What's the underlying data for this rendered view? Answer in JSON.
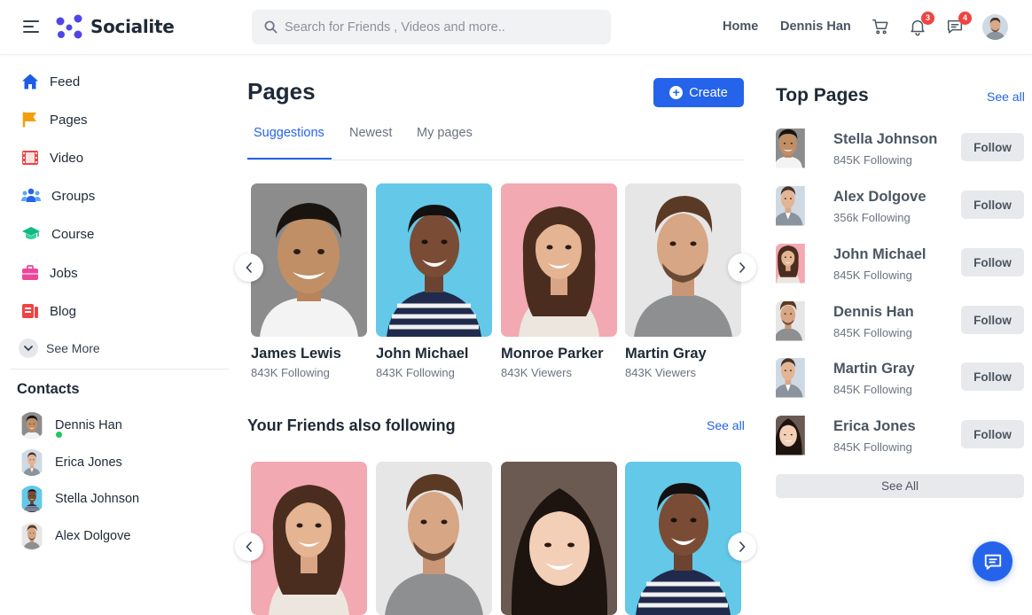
{
  "header": {
    "app_name": "Socialite",
    "search_placeholder": "Search for Friends , Videos and more..",
    "nav_home": "Home",
    "nav_user": "Dennis Han",
    "notifications_count": "3",
    "messages_count": "4",
    "icons": [
      "menu-icon",
      "logo-icon",
      "search-icon",
      "cart-icon",
      "bell-icon",
      "message-icon",
      "avatar"
    ]
  },
  "sidebar": {
    "items": [
      {
        "label": "Feed",
        "icon": "home-icon"
      },
      {
        "label": "Pages",
        "icon": "flag-icon"
      },
      {
        "label": "Video",
        "icon": "film-icon"
      },
      {
        "label": "Groups",
        "icon": "groups-icon"
      },
      {
        "label": "Course",
        "icon": "graduation-cap-icon"
      },
      {
        "label": "Jobs",
        "icon": "briefcase-icon"
      },
      {
        "label": "Blog",
        "icon": "blog-icon"
      }
    ],
    "see_more": "See More",
    "contacts_title": "Contacts",
    "contacts": [
      {
        "name": "Dennis Han",
        "online": true
      },
      {
        "name": "Erica Jones",
        "online": false
      },
      {
        "name": "Stella Johnson",
        "online": false
      },
      {
        "name": "Alex Dolgove",
        "online": false
      }
    ]
  },
  "main": {
    "title": "Pages",
    "create_label": "Create",
    "tabs": [
      {
        "label": "Suggestions",
        "active": true
      },
      {
        "label": "Newest",
        "active": false
      },
      {
        "label": "My pages",
        "active": false
      }
    ],
    "suggestions": [
      {
        "name": "James Lewis",
        "sub": "843K Following"
      },
      {
        "name": "John Michael",
        "sub": "843K Following"
      },
      {
        "name": "Monroe Parker",
        "sub": "843K Viewers"
      },
      {
        "name": "Martin Gray",
        "sub": "843K Viewers"
      }
    ],
    "friends_title": "Your Friends also following",
    "friends_see_all": "See all"
  },
  "right": {
    "title": "Top Pages",
    "see_all": "See all",
    "follow_label": "Follow",
    "pages": [
      {
        "name": "Stella Johnson",
        "sub": "845K Following"
      },
      {
        "name": "Alex Dolgove",
        "sub": "356k Following"
      },
      {
        "name": "John Michael",
        "sub": "845K Following"
      },
      {
        "name": "Dennis Han",
        "sub": "845K Following"
      },
      {
        "name": "Martin Gray",
        "sub": "845K Following"
      },
      {
        "name": "Erica Jones",
        "sub": "845K Following"
      }
    ],
    "see_all_button": "See All"
  },
  "colors": {
    "accent": "#2563eb",
    "badge": "#ef4444",
    "online": "#22c55e"
  }
}
